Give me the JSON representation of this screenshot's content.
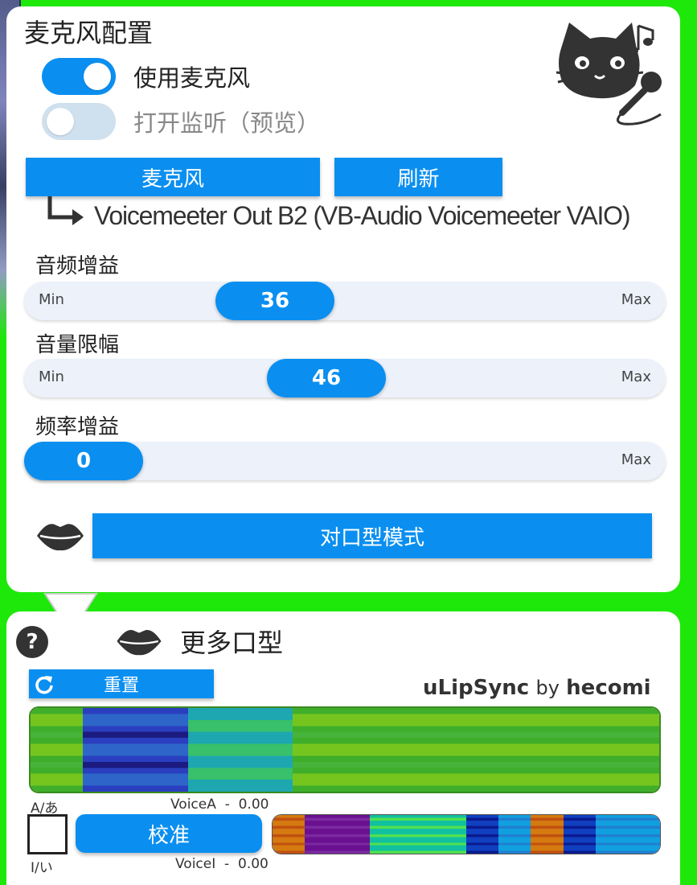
{
  "mic_config": {
    "title": "麦克风配置",
    "use_mic_label": "使用麦克风",
    "use_mic_on": true,
    "monitor_label": "打开监听（预览）",
    "monitor_on": false,
    "mic_button": "麦克风",
    "refresh_button": "刷新",
    "device_name": "Voicemeeter Out B2 (VB-Audio Voicemeeter VAIO)",
    "sliders": [
      {
        "label": "音频增益",
        "min_label": "Min",
        "max_label": "Max",
        "value": "36",
        "fraction": 0.27
      },
      {
        "label": "音量限幅",
        "min_label": "Min",
        "max_label": "Max",
        "value": "46",
        "fraction": 0.37
      },
      {
        "label": "频率增益",
        "min_label": "",
        "max_label": "Max",
        "value": "0",
        "fraction": 0.0
      }
    ],
    "lip_mode_button": "对口型模式"
  },
  "more_shapes": {
    "title": "更多口型",
    "reset_button": "重置",
    "brand": {
      "part1": "uLipSync",
      "by": "by",
      "part2": "hecomi"
    },
    "entries": [
      {
        "label": "A/あ",
        "voice": "VoiceA  -  0.00",
        "calibrate": "校准"
      },
      {
        "label": "I/い",
        "voice": "VoiceI  -  0.00"
      }
    ]
  },
  "colors": {
    "accent": "#0a8ff0",
    "toggle_off": "#cfe0ee",
    "bg": "#1ee80a"
  }
}
